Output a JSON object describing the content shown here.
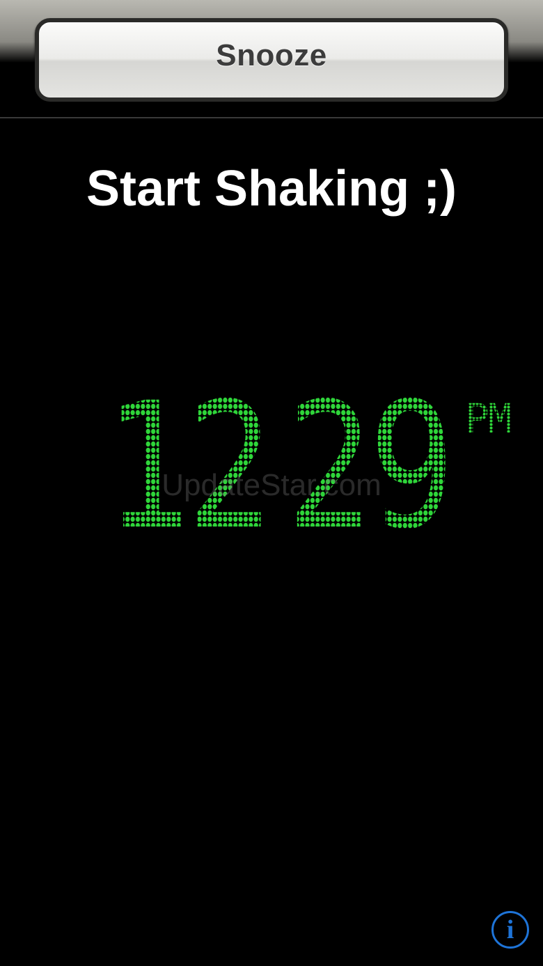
{
  "snooze": {
    "label": "Snooze"
  },
  "heading": {
    "text": "Start Shaking ;)"
  },
  "clock": {
    "hours": "12",
    "minutes": "29",
    "ampm": "PM",
    "color": "#2fd63a"
  },
  "watermark": {
    "text": "UpdateStar.com"
  },
  "info": {
    "icon": "info-icon",
    "glyph": "i",
    "color": "#1e74d8"
  }
}
